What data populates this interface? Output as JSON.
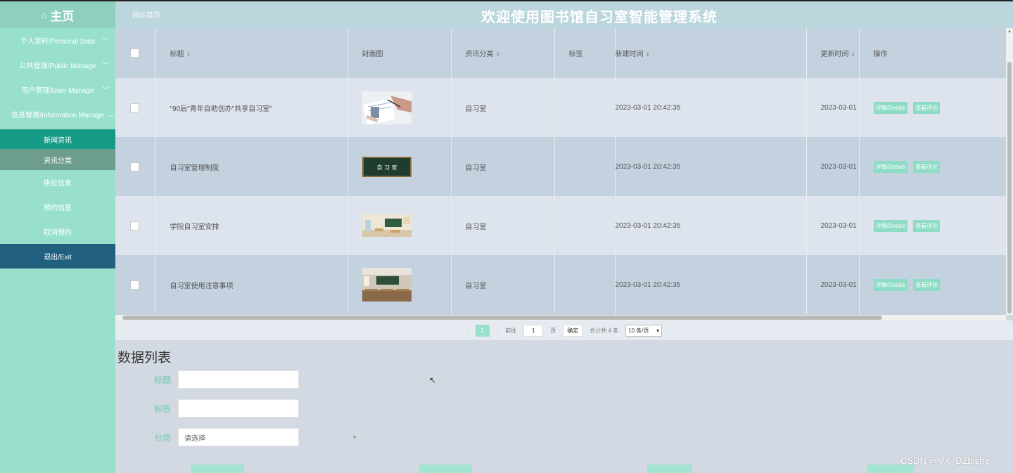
{
  "header": {
    "home_label": "主页",
    "site_link": "网站首页",
    "title": "欢迎使用图书馆自习室智能管理系统"
  },
  "sidebar": {
    "menu": [
      {
        "label": "个人资料/Personal Data"
      },
      {
        "label": "公共管理/Public Manage"
      },
      {
        "label": "用户管理/User Manage"
      },
      {
        "label": "信息管理/Information Manage"
      }
    ],
    "sub_items": [
      {
        "label": "新闻资讯"
      },
      {
        "label": "资讯分类"
      },
      {
        "label": "座位信息"
      },
      {
        "label": "预约信息"
      },
      {
        "label": "取消预约"
      }
    ],
    "exit_label": "退出/Exit"
  },
  "table": {
    "headers": {
      "title": "标题",
      "cover": "封面图",
      "category": "资讯分类",
      "tags": "标签",
      "created": "新建时间",
      "updated": "更新时间",
      "ops": "操作"
    },
    "rows": [
      {
        "title": "\"90后\"青年自助创办\"共享自习室\"",
        "category": "自习室",
        "created": "2023-03-01 20:42:35",
        "updated": "2023-03-01"
      },
      {
        "title": "自习室管理制度",
        "category": "自习室",
        "created": "2023-03-01 20:42:35",
        "updated": "2023-03-01"
      },
      {
        "title": "学院自习室安排",
        "category": "自习室",
        "created": "2023-03-01 20:42:35",
        "updated": "2023-03-01"
      },
      {
        "title": "自习室使用注意事项",
        "category": "自习室",
        "created": "2023-03-01 20:42:35",
        "updated": "2023-03-01"
      }
    ],
    "btn_details": "详情/Details",
    "btn_comments": "查看评论",
    "cover2_text": "自 习 室"
  },
  "pager": {
    "current": "1",
    "goto_label": "前往",
    "goto_value": "1",
    "page_unit": "页",
    "confirm": "确定",
    "total": "合计共 4 条",
    "page_size": "10 条/页"
  },
  "form": {
    "section_title": "数据列表",
    "title_label": "标题",
    "tag_label": "标签",
    "category_label": "分类",
    "category_placeholder": "请选择"
  },
  "watermark": "CSDN @VX_DZbishe",
  "colors": {
    "header": "#bcd6dd",
    "sidebar": "#98e0cb",
    "active_sub": "#159a85",
    "exit": "#215f7f",
    "accent": "#8fcfbd"
  }
}
